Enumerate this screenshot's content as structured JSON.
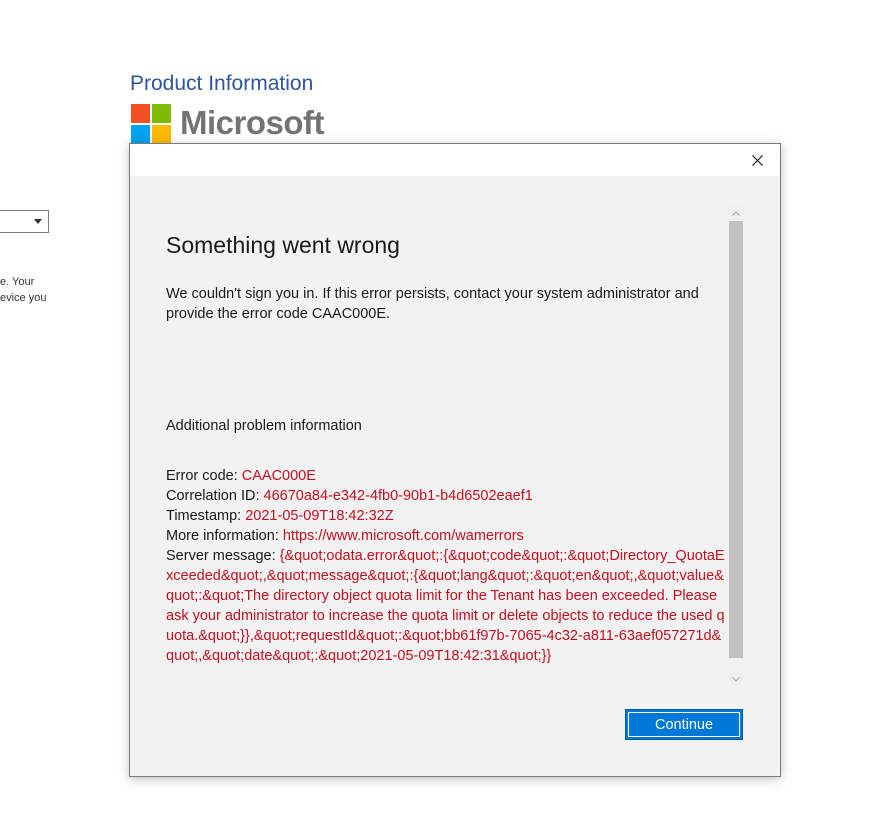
{
  "background": {
    "title": "Product Information",
    "brand": "Microsoft",
    "text_line1": "e.  Your",
    "text_line2": "evice you"
  },
  "dialog": {
    "heading": "Something went wrong",
    "message": "We couldn't sign you in. If this error persists, contact your system administrator and provide the error code CAAC000E.",
    "additional_title": "Additional problem information",
    "details": {
      "error_code_label": "Error code: ",
      "error_code": "CAAC000E",
      "correlation_label": "Correlation ID: ",
      "correlation_id": "46670a84-e342-4fb0-90b1-b4d6502eaef1",
      "timestamp_label": "Timestamp: ",
      "timestamp": "2021-05-09T18:42:32Z",
      "more_info_label": "More information: ",
      "more_info_link": "https://www.microsoft.com/wamerrors",
      "server_message_label": "Server message: ",
      "server_message": "{&quot;odata.error&quot;:{&quot;code&quot;:&quot;Directory_QuotaExceeded&quot;,&quot;message&quot;:{&quot;lang&quot;:&quot;en&quot;,&quot;value&quot;:&quot;The directory object quota limit for the Tenant has been exceeded. Please ask your administrator to increase the quota limit or delete objects to reduce the used quota.&quot;}},&quot;requestId&quot;:&quot;bb61f97b-7065-4c32-a811-63aef057271d&quot;,&quot;date&quot;:&quot;2021-05-09T18:42:31&quot;}}"
    },
    "continue_label": "Continue"
  },
  "colors": {
    "error_red": "#c50f1f",
    "accent_blue": "#0078d7",
    "title_blue": "#2b579a"
  }
}
